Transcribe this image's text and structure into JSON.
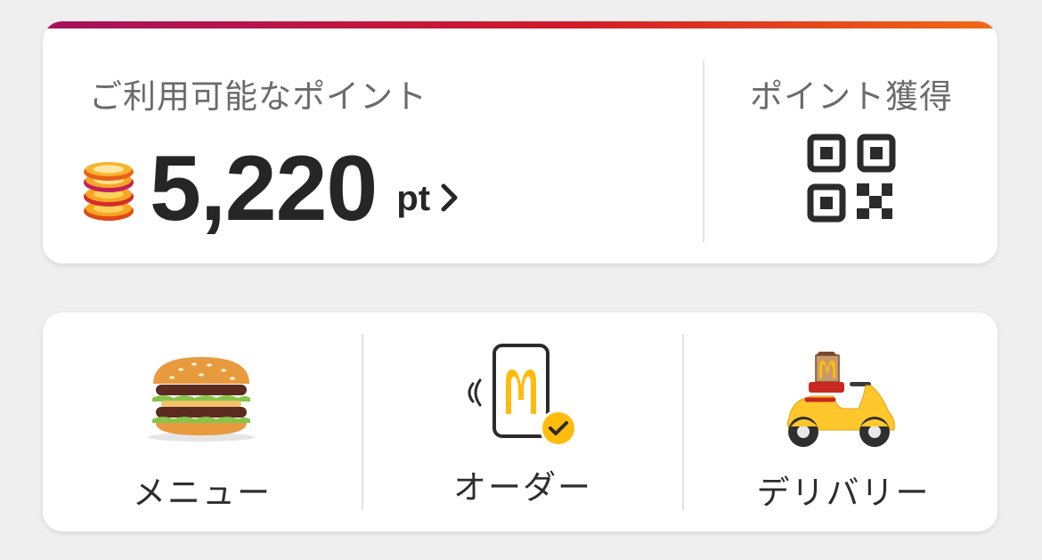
{
  "points": {
    "label": "ご利用可能なポイント",
    "value": "5,220",
    "unit": "pt",
    "coin_icon": "coin-stack-icon",
    "chevron_icon": "chevron-right-icon"
  },
  "earn_points": {
    "label": "ポイント獲得",
    "icon": "qr-code-icon"
  },
  "actions": [
    {
      "label": "メニュー",
      "icon": "burger-icon"
    },
    {
      "label": "オーダー",
      "icon": "mobile-order-icon"
    },
    {
      "label": "デリバリー",
      "icon": "delivery-scooter-icon"
    }
  ],
  "colors": {
    "accent_start": "#a4125e",
    "accent_mid": "#d11a2a",
    "accent_end": "#f06a14",
    "brand_yellow": "#ffbc0d",
    "text_primary": "#262626",
    "text_secondary": "#6b6b6b"
  }
}
